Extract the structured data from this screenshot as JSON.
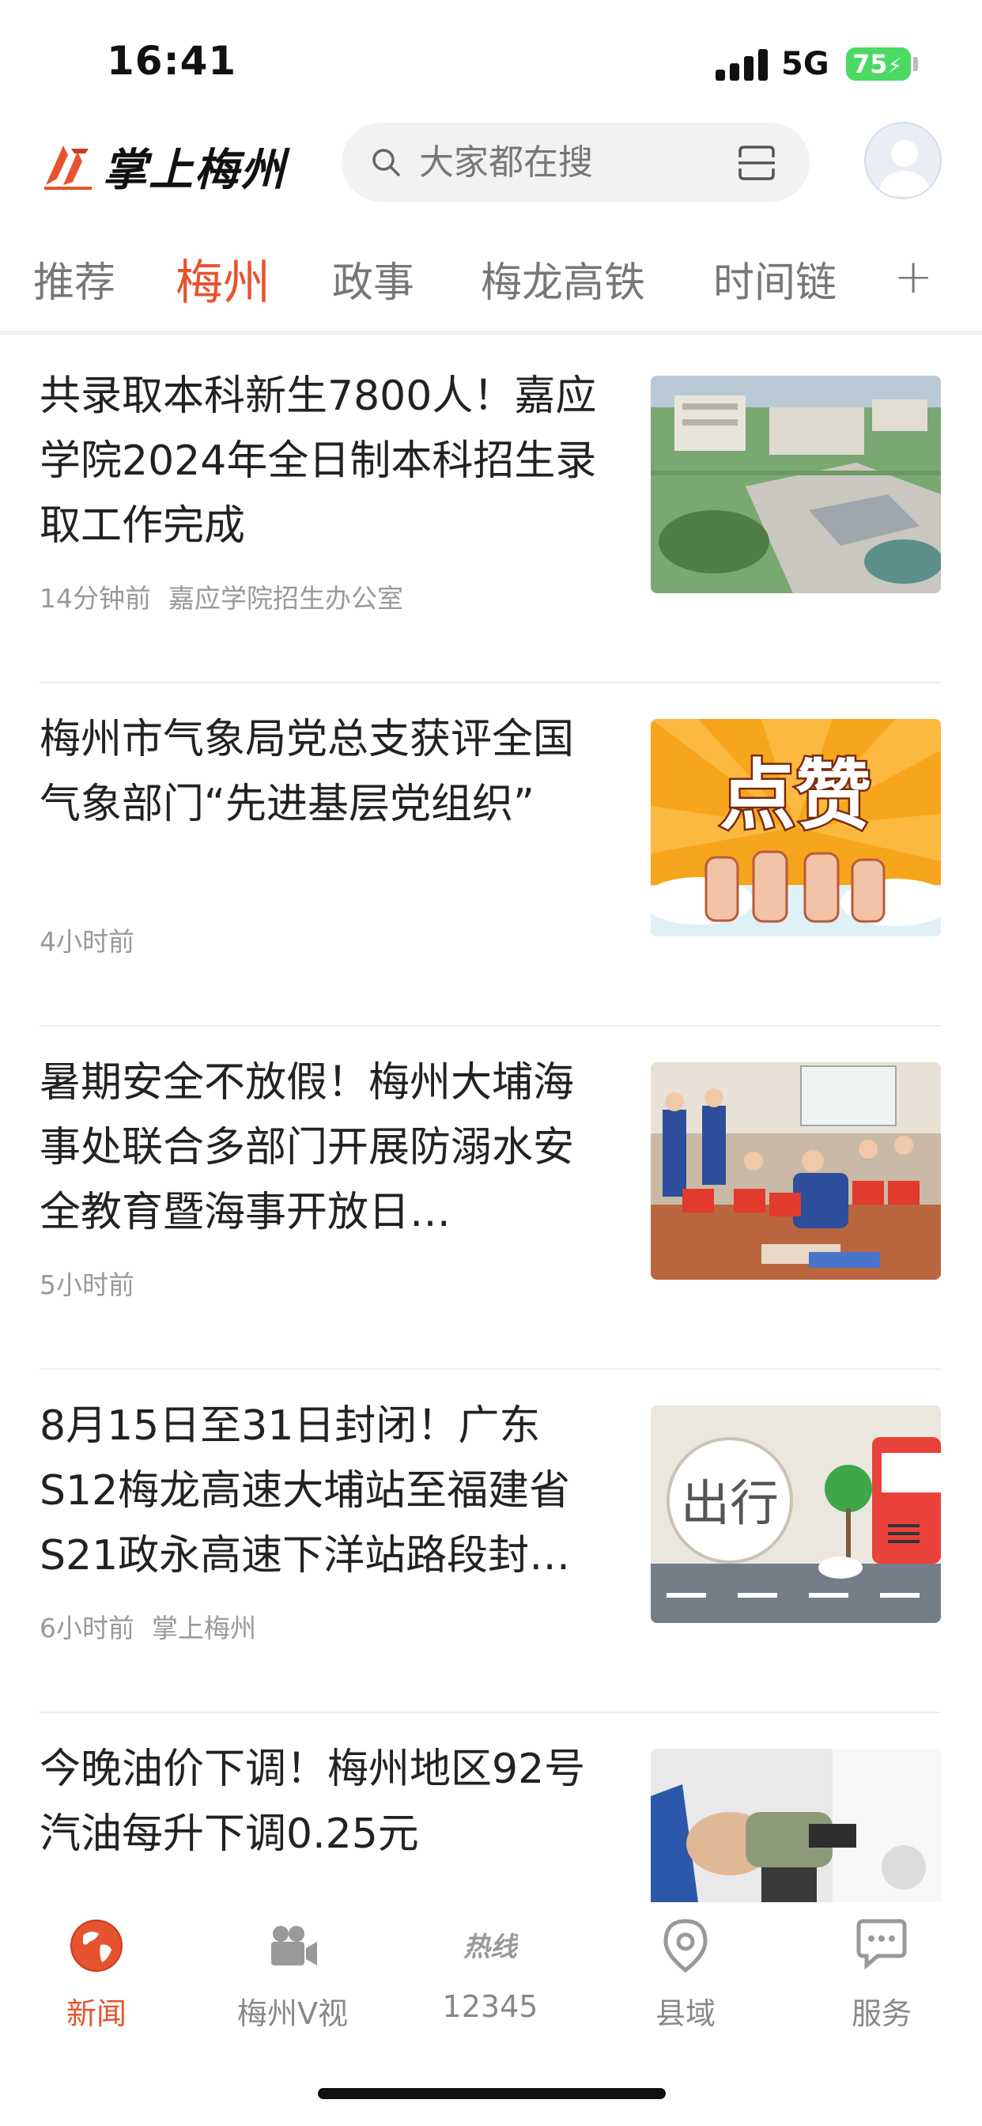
{
  "status_bar": {
    "time": "16:41",
    "network": "5G",
    "battery": "75"
  },
  "header": {
    "logo_text": "掌上梅州",
    "search_placeholder": "大家都在搜"
  },
  "tabs": [
    {
      "label": "推荐"
    },
    {
      "label": "梅州"
    },
    {
      "label": "政事"
    },
    {
      "label": "梅龙高铁"
    },
    {
      "label": "时间链"
    }
  ],
  "tab_add": "+",
  "news": [
    {
      "title": "共录取本科新生7800人！嘉应学院2024年全日制本科招生录取工作完成",
      "time": "14分钟前",
      "source": "嘉应学院招生办公室",
      "thumb": "campus-photo"
    },
    {
      "title": "梅州市气象局党总支获评全国气象部门“先进基层党组织”",
      "time": "4小时前",
      "source": "",
      "thumb": "thumbs-up-illustration",
      "thumb_text": "点赞"
    },
    {
      "title": "暑期安全不放假！梅州大埔海事处联合多部门开展防溺水安全教育暨海事开放日…",
      "time": "5小时前",
      "source": "",
      "thumb": "cpr-training-photo"
    },
    {
      "title": "8月15日至31日封闭！广东S12梅龙高速大埔站至福建省S21政永高速下洋站路段封…",
      "time": "6小时前",
      "source": "掌上梅州",
      "thumb": "travel-illustration",
      "thumb_text": "出行"
    },
    {
      "title": "今晚油价下调！梅州地区92号汽油每升下调0.25元",
      "time": "",
      "source": "",
      "thumb": "fuel-nozzle-photo"
    }
  ],
  "bottom_nav": [
    {
      "label": "新闻",
      "icon": "globe-icon"
    },
    {
      "label": "梅州V视",
      "icon": "video-camera-icon"
    },
    {
      "label": "12345",
      "icon": "hotline-icon",
      "icon_text": "热线"
    },
    {
      "label": "县域",
      "icon": "location-pin-icon"
    },
    {
      "label": "服务",
      "icon": "chat-bubble-icon"
    }
  ],
  "colors": {
    "accent": "#e8532f",
    "inactive": "#888888",
    "battery": "#4cd964"
  }
}
